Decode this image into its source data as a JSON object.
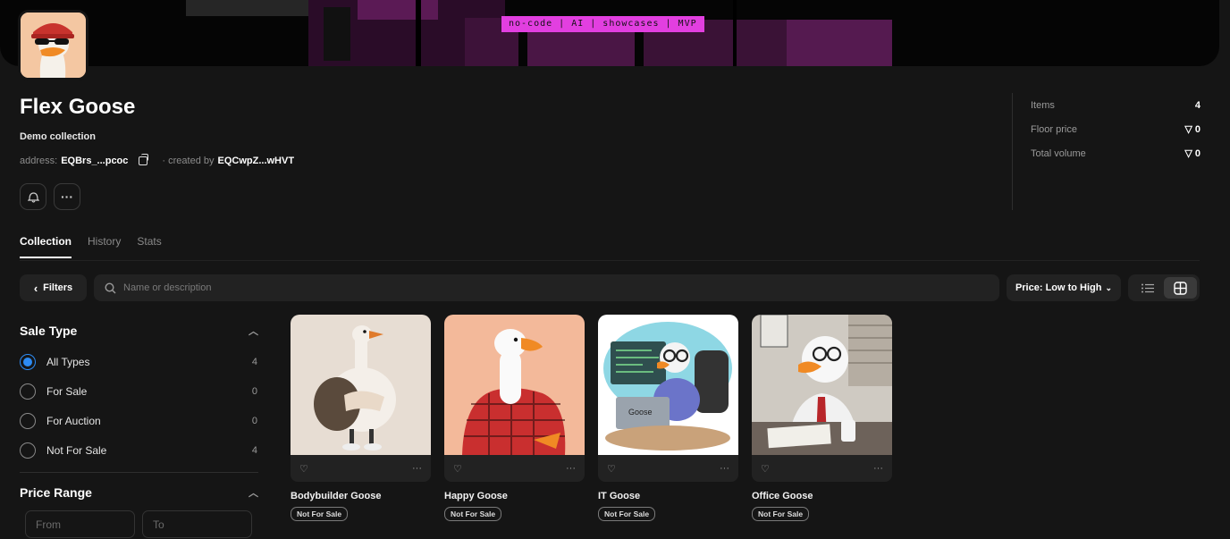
{
  "banner": {
    "tag": "no-code | AI | showcases | MVP"
  },
  "collection": {
    "title": "Flex Goose",
    "subtitle": "Demo collection",
    "address_label": "address:",
    "address": "EQBrs_...pcoc",
    "created_by_label": "· created by",
    "creator": "EQCwpZ...wHVT"
  },
  "stats": [
    {
      "label": "Items",
      "value": "4"
    },
    {
      "label": "Floor price",
      "value": "0",
      "icon": "ton-icon"
    },
    {
      "label": "Total volume",
      "value": "0",
      "icon": "ton-icon"
    }
  ],
  "tabs": [
    {
      "label": "Collection",
      "active": true
    },
    {
      "label": "History"
    },
    {
      "label": "Stats"
    }
  ],
  "toolbar": {
    "filters_label": "Filters",
    "search_placeholder": "Name or description",
    "sort_label": "Price: Low to High"
  },
  "sidebar": {
    "sale_type_title": "Sale Type",
    "options": [
      {
        "label": "All Types",
        "count": "4",
        "selected": true
      },
      {
        "label": "For Sale",
        "count": "0"
      },
      {
        "label": "For Auction",
        "count": "0"
      },
      {
        "label": "Not For Sale",
        "count": "4"
      }
    ],
    "price_range_title": "Price Range",
    "from_placeholder": "From",
    "to_placeholder": "To"
  },
  "items": [
    {
      "name": "Bodybuilder Goose",
      "status": "Not For Sale",
      "bg": "#e7ddd3"
    },
    {
      "name": "Happy Goose",
      "status": "Not For Sale",
      "bg": "#f3b99a"
    },
    {
      "name": "IT Goose",
      "status": "Not For Sale",
      "bg": "#d9eef2"
    },
    {
      "name": "Office Goose",
      "status": "Not For Sale",
      "bg": "#cfcac2"
    }
  ]
}
